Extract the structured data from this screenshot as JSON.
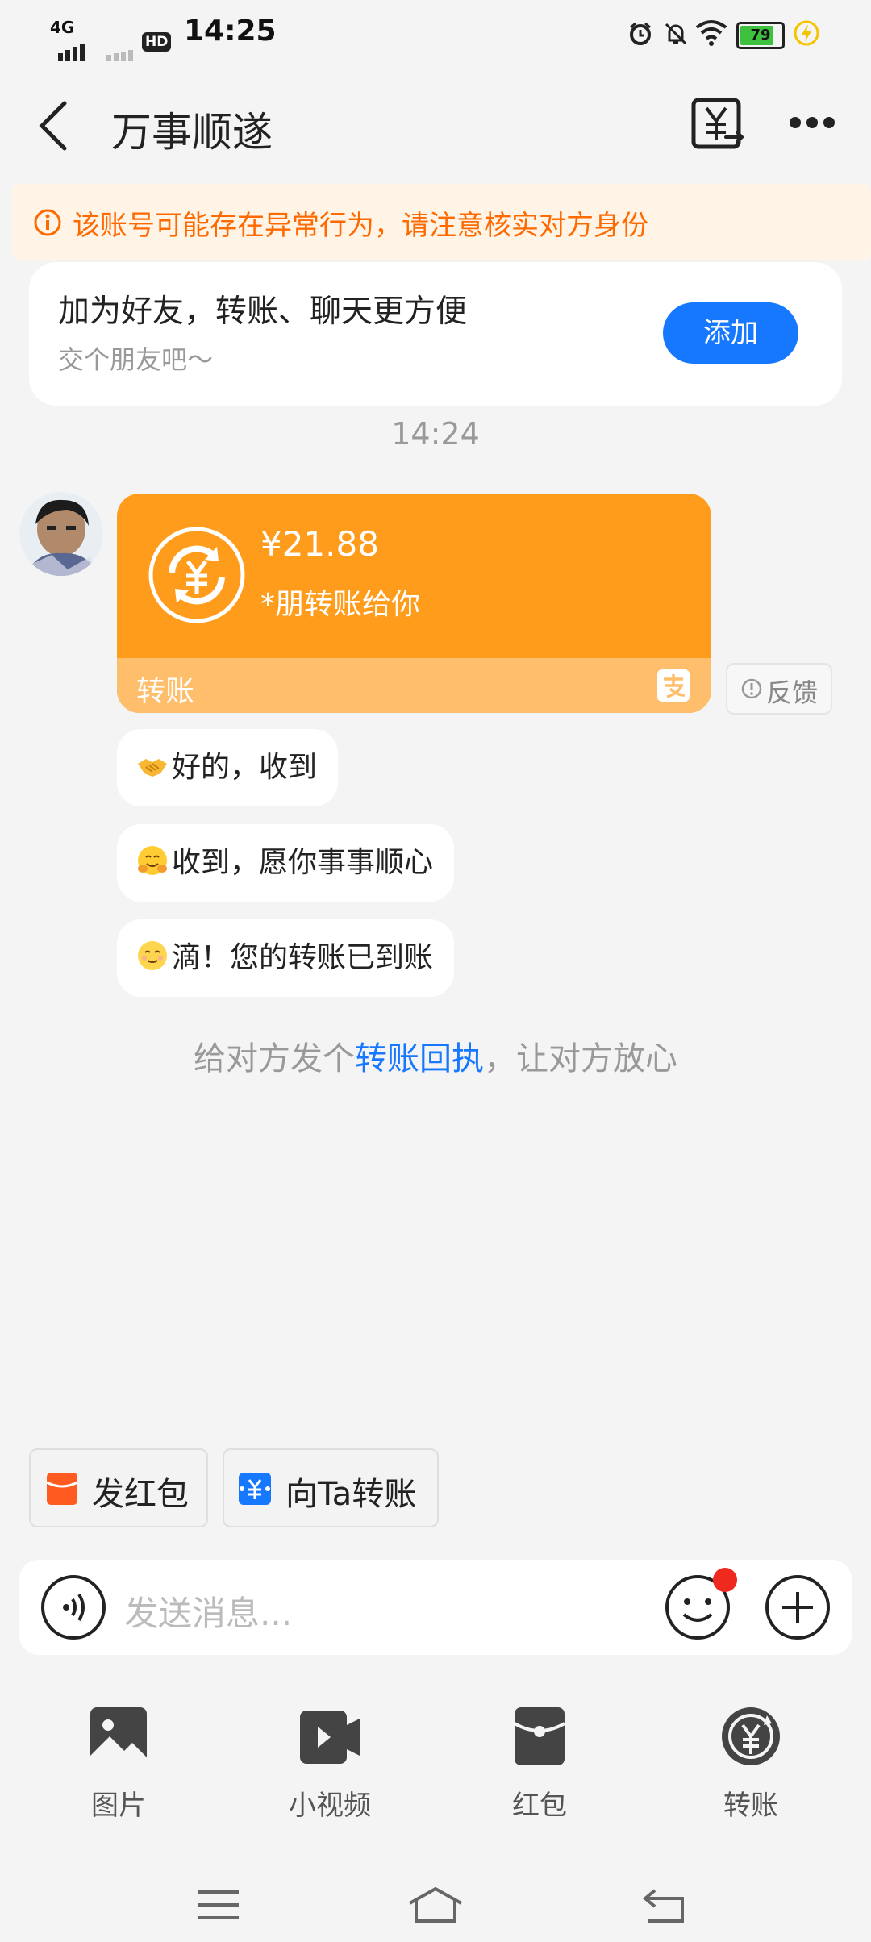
{
  "status_bar": {
    "network": "4G",
    "hd": "HD",
    "time": "14:25",
    "battery": "79"
  },
  "header": {
    "title": "万事顺遂"
  },
  "warning": {
    "text": "该账号可能存在异常行为，请注意核实对方身份"
  },
  "friend_card": {
    "title": "加为好友，转账、聊天更方便",
    "subtitle": "交个朋友吧～",
    "button": "添加"
  },
  "chat": {
    "timestamp": "14:24",
    "transfer": {
      "amount": "¥21.88",
      "sender": "*朋转账给你",
      "footer": "转账",
      "feedback": "反馈"
    },
    "messages": [
      {
        "text": "好的，收到",
        "emoji": "handshake"
      },
      {
        "text": "收到，愿你事事顺心",
        "emoji": "hugging-face"
      },
      {
        "text": "滴！您的转账已到账",
        "emoji": "smiling-face"
      }
    ],
    "receipt_prefix": "给对方发个",
    "receipt_link": "转账回执",
    "receipt_suffix": "，让对方放心"
  },
  "quick_actions": {
    "red_packet": "发红包",
    "transfer": "向Ta转账"
  },
  "input": {
    "placeholder": "发送消息..."
  },
  "tools": [
    {
      "label": "图片",
      "icon": "image-icon"
    },
    {
      "label": "小视频",
      "icon": "video-icon"
    },
    {
      "label": "红包",
      "icon": "red-packet-icon"
    },
    {
      "label": "转账",
      "icon": "transfer-icon"
    }
  ],
  "colors": {
    "accent": "#1677ff",
    "transfer_orange": "#ff9c1c",
    "warning": "#ff6a00"
  }
}
